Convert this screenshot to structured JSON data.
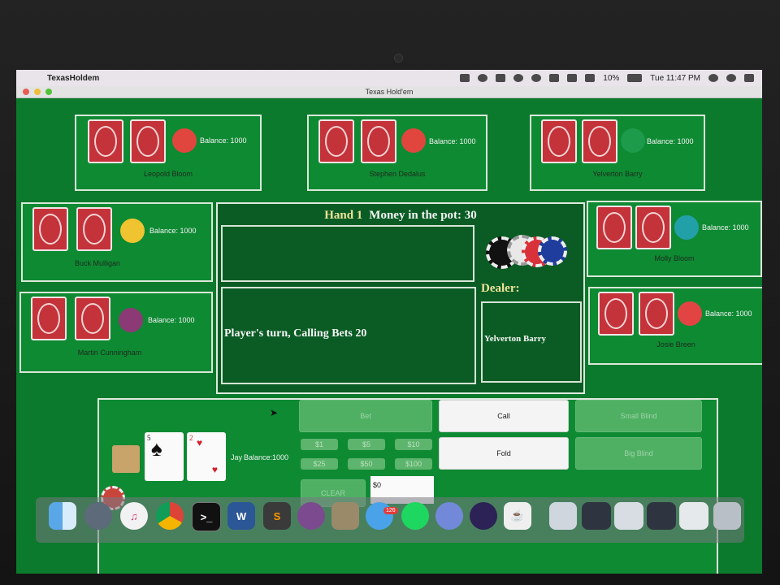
{
  "menubar": {
    "app_name": "TexasHoldem",
    "battery": "10%",
    "clock": "Tue 11:47 PM"
  },
  "window": {
    "title": "Texas Hold'em"
  },
  "opponents": [
    {
      "name": "Leopold Bloom",
      "balance": "Balance: 1000",
      "avatar_color": "#e0463e",
      "avatar_icon": "frog-avatar-icon"
    },
    {
      "name": "Stephen Dedalus",
      "balance": "Balance: 1000",
      "avatar_color": "#e0463e",
      "avatar_icon": "horse-avatar-icon"
    },
    {
      "name": "Yelverton Barry",
      "balance": "Balance: 1000",
      "avatar_color": "#1d9a4a",
      "avatar_icon": "woman-avatar-icon"
    },
    {
      "name": "Buck Mulligan",
      "balance": "Balance: 1000",
      "avatar_color": "#f0c331",
      "avatar_icon": "wolverine-avatar-icon"
    },
    {
      "name": "Molly Bloom",
      "balance": "Balance: 1000",
      "avatar_color": "#22a0a8",
      "avatar_icon": "woman-avatar-icon"
    },
    {
      "name": "Martin Cunningham",
      "balance": "Balance: 1000",
      "avatar_color": "#8b3a76",
      "avatar_icon": "man-avatar-icon"
    },
    {
      "name": "Josie Breen",
      "balance": "Balance: 1000",
      "avatar_color": "#e24444",
      "avatar_icon": "captain-avatar-icon"
    }
  ],
  "center": {
    "hand_label": "Hand 1",
    "pot_label": "Money in the pot: 30",
    "status_text": "Player's turn, Calling Bets 20",
    "dealer_label": "Dealer:",
    "dealer_name": "Yelverton Barry"
  },
  "player": {
    "name": "Jay",
    "balance": "Balance:1000",
    "cards": [
      {
        "rank": "5",
        "suit": "♠",
        "color": "#111111"
      },
      {
        "rank": "2",
        "suit": "♥",
        "color": "#d4202a"
      }
    ]
  },
  "controls": {
    "bet": "Bet",
    "call": "Call",
    "fold": "Fold",
    "small_blind": "Small Blind",
    "big_blind": "Big Blind",
    "chips": [
      "$1",
      "$5",
      "$10",
      "$25",
      "$50",
      "$100"
    ],
    "clear": "CLEAR",
    "amount_value": "$0"
  },
  "dock": {
    "messages_badge": "126",
    "apps": [
      "finder-icon",
      "launchpad-icon",
      "itunes-icon",
      "chrome-icon",
      "terminal-icon",
      "word-icon",
      "sublime-icon",
      "github-icon",
      "keychain-icon",
      "messages-icon",
      "spotify-icon",
      "discord-icon",
      "eclipse-icon",
      "java-icon",
      "archive-icon",
      "window-thumb-icon",
      "window-thumb-icon",
      "window-thumb-icon",
      "window-thumb-icon",
      "trash-icon"
    ]
  }
}
